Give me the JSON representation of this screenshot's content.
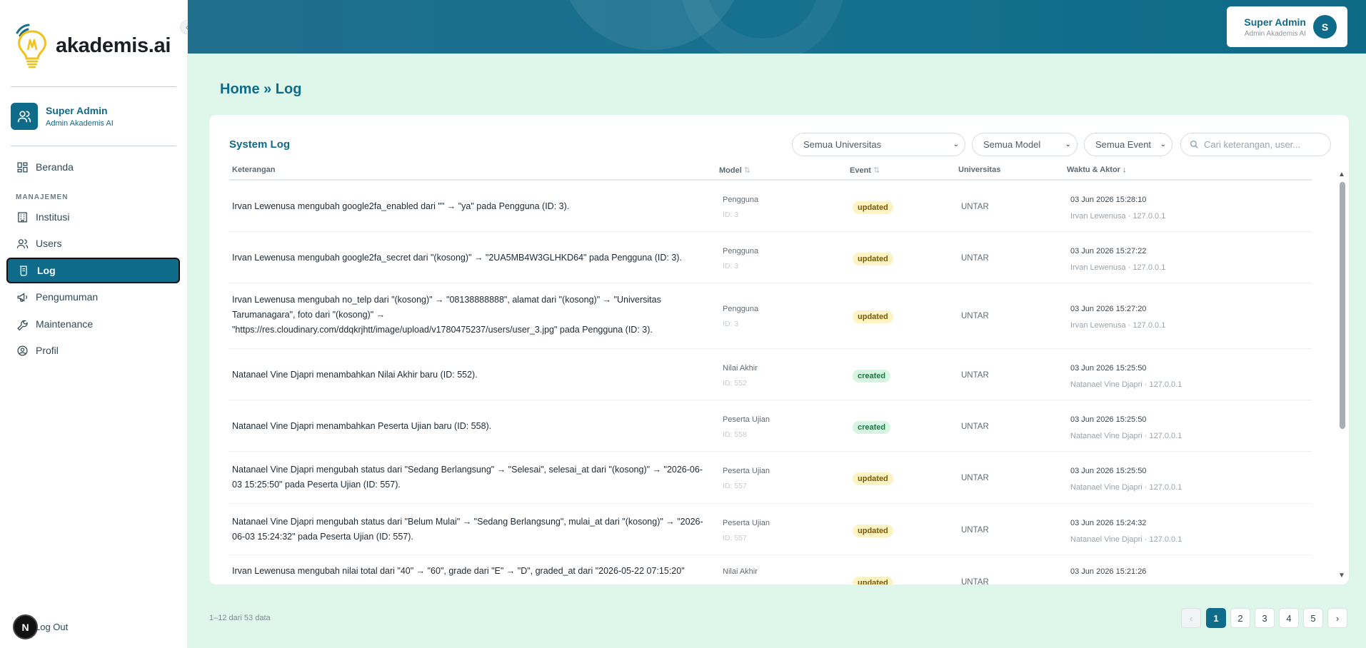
{
  "brand": {
    "name": "akademis.ai"
  },
  "sidebar": {
    "user": {
      "name": "Super Admin",
      "role": "Admin Akademis AI"
    },
    "home": "Beranda",
    "section": "MANAJEMEN",
    "items": [
      {
        "label": "Institusi",
        "icon": "building-icon"
      },
      {
        "label": "Users",
        "icon": "users-icon"
      },
      {
        "label": "Log",
        "icon": "log-icon",
        "active": true
      },
      {
        "label": "Pengumuman",
        "icon": "megaphone-icon"
      },
      {
        "label": "Maintenance",
        "icon": "wrench-icon"
      },
      {
        "label": "Profil",
        "icon": "profile-icon"
      }
    ],
    "logout": "Log Out",
    "dev_badge": "N"
  },
  "topbar": {
    "user_name": "Super Admin",
    "user_role": "Admin Akademis AI",
    "avatar_initial": "S"
  },
  "breadcrumb": "Home » Log",
  "card": {
    "title": "System Log",
    "filters": {
      "universitas": "Semua Universitas",
      "model": "Semua Model",
      "event": "Semua Event"
    },
    "search_placeholder": "Cari keterangan, user...",
    "columns": {
      "keterangan": "Keterangan",
      "model": "Model",
      "event": "Event",
      "universitas": "Universitas",
      "waktu": "Waktu & Aktor"
    },
    "sort_neutral": "⇅",
    "sort_down": "↓"
  },
  "rows": [
    {
      "desc": "Irvan Lewenusa mengubah google2fa_enabled dari \"\" → \"ya\" pada Pengguna (ID: 3).",
      "model": "Pengguna",
      "model_id": "ID: 3",
      "event": "updated",
      "univ": "UNTAR",
      "time": "03 Jun 2026 15:28:10",
      "actor": "Irvan Lewenusa · 127.0.0.1"
    },
    {
      "desc": "Irvan Lewenusa mengubah google2fa_secret dari \"(kosong)\" → \"2UA5MB4W3GLHKD64\" pada Pengguna (ID: 3).",
      "model": "Pengguna",
      "model_id": "ID: 3",
      "event": "updated",
      "univ": "UNTAR",
      "time": "03 Jun 2026 15:27:22",
      "actor": "Irvan Lewenusa · 127.0.0.1"
    },
    {
      "desc": "Irvan Lewenusa mengubah no_telp dari \"(kosong)\" → \"08138888888\", alamat dari \"(kosong)\" → \"Universitas Tarumanagara\", foto dari \"(kosong)\" → \"https://res.cloudinary.com/ddqkrjhtt/image/upload/v1780475237/users/user_3.jpg\" pada Pengguna (ID: 3).",
      "model": "Pengguna",
      "model_id": "ID: 3",
      "event": "updated",
      "univ": "UNTAR",
      "time": "03 Jun 2026 15:27:20",
      "actor": "Irvan Lewenusa · 127.0.0.1"
    },
    {
      "desc": "Natanael Vine Djapri menambahkan Nilai Akhir baru (ID: 552).",
      "model": "Nilai Akhir",
      "model_id": "ID: 552",
      "event": "created",
      "univ": "UNTAR",
      "time": "03 Jun 2026 15:25:50",
      "actor": "Natanael Vine Djapri · 127.0.0.1"
    },
    {
      "desc": "Natanael Vine Djapri menambahkan Peserta Ujian baru (ID: 558).",
      "model": "Peserta Ujian",
      "model_id": "ID: 558",
      "event": "created",
      "univ": "UNTAR",
      "time": "03 Jun 2026 15:25:50",
      "actor": "Natanael Vine Djapri · 127.0.0.1"
    },
    {
      "desc": "Natanael Vine Djapri mengubah status dari \"Sedang Berlangsung\" → \"Selesai\", selesai_at dari \"(kosong)\" → \"2026-06-03 15:25:50\" pada Peserta Ujian (ID: 557).",
      "model": "Peserta Ujian",
      "model_id": "ID: 557",
      "event": "updated",
      "univ": "UNTAR",
      "time": "03 Jun 2026 15:25:50",
      "actor": "Natanael Vine Djapri · 127.0.0.1"
    },
    {
      "desc": "Natanael Vine Djapri mengubah status dari \"Belum Mulai\" → \"Sedang Berlangsung\", mulai_at dari \"(kosong)\" → \"2026-06-03 15:24:32\" pada Peserta Ujian (ID: 557).",
      "model": "Peserta Ujian",
      "model_id": "ID: 557",
      "event": "updated",
      "univ": "UNTAR",
      "time": "03 Jun 2026 15:24:32",
      "actor": "Natanael Vine Djapri · 127.0.0.1"
    },
    {
      "desc": "Irvan Lewenusa mengubah nilai total dari \"40\" → \"60\", grade dari \"E\" → \"D\", graded_at dari \"2026-05-22 07:15:20\"",
      "model": "Nilai Akhir",
      "model_id": "",
      "event": "updated",
      "univ": "UNTAR",
      "time": "03 Jun 2026 15:21:26",
      "actor": ""
    }
  ],
  "footer": {
    "info": "1–12 dari 53 data",
    "pages": [
      "1",
      "2",
      "3",
      "4",
      "5"
    ],
    "prev": "‹",
    "next": "›"
  },
  "colors": {
    "primary": "#0e6b8a",
    "page_bg": "#dff6ea",
    "updated_bg": "#fdf3c4",
    "created_bg": "#d8f5e3"
  }
}
